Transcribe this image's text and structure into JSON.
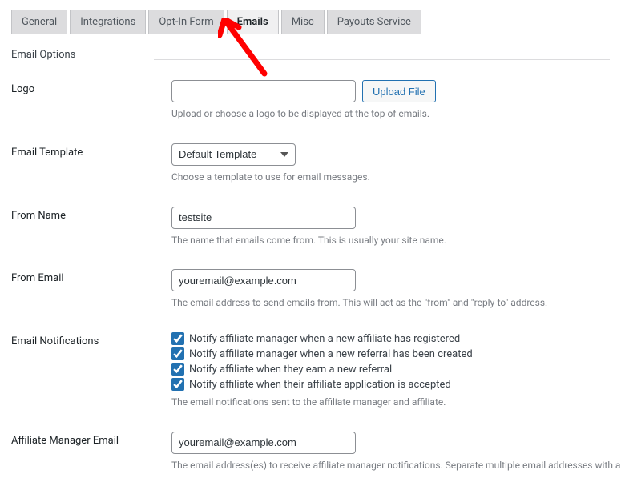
{
  "tabs": [
    {
      "label": "General"
    },
    {
      "label": "Integrations"
    },
    {
      "label": "Opt-In Form"
    },
    {
      "label": "Emails",
      "active": true
    },
    {
      "label": "Misc"
    },
    {
      "label": "Payouts Service"
    }
  ],
  "section": {
    "title": "Email Options"
  },
  "logo": {
    "label": "Logo",
    "value": "",
    "button": "Upload File",
    "help": "Upload or choose a logo to be displayed at the top of emails."
  },
  "template": {
    "label": "Email Template",
    "value": "Default Template",
    "help": "Choose a template to use for email messages."
  },
  "from_name": {
    "label": "From Name",
    "value": "testsite",
    "help": "The name that emails come from. This is usually your site name."
  },
  "from_email": {
    "label": "From Email",
    "value": "youremail@example.com",
    "help": "The email address to send emails from. This will act as the \"from\" and \"reply-to\" address."
  },
  "notifications": {
    "label": "Email Notifications",
    "items": [
      {
        "label": "Notify affiliate manager when a new affiliate has registered",
        "checked": true
      },
      {
        "label": "Notify affiliate manager when a new referral has been created",
        "checked": true
      },
      {
        "label": "Notify affiliate when they earn a new referral",
        "checked": true
      },
      {
        "label": "Notify affiliate when their affiliate application is accepted",
        "checked": true
      }
    ],
    "help": "The email notifications sent to the affiliate manager and affiliate."
  },
  "manager_email": {
    "label": "Affiliate Manager Email",
    "value": "youremail@example.com",
    "help": "The email address(es) to receive affiliate manager notifications. Separate multiple email addresses with a comma (,). The adm"
  }
}
